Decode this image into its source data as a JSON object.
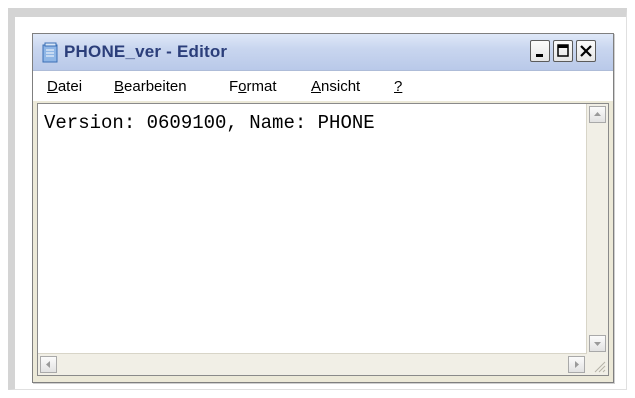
{
  "window": {
    "title": "PHONE_ver - Editor",
    "title_color": "#2b3e7a"
  },
  "menu": {
    "items": [
      {
        "mnemonic": "D",
        "rest": "atei"
      },
      {
        "mnemonic": "B",
        "rest": "earbeiten"
      },
      {
        "pre": "F",
        "mnemonic": "o",
        "rest": "rmat"
      },
      {
        "mnemonic": "A",
        "rest": "nsicht"
      },
      {
        "mnemonic": "?",
        "rest": ""
      }
    ]
  },
  "editor": {
    "content": "Version: 0609100, Name: PHONE"
  },
  "icons": {
    "app": "notepad-icon",
    "minimize": "minimize-icon",
    "maximize": "maximize-icon",
    "close": "close-icon"
  }
}
